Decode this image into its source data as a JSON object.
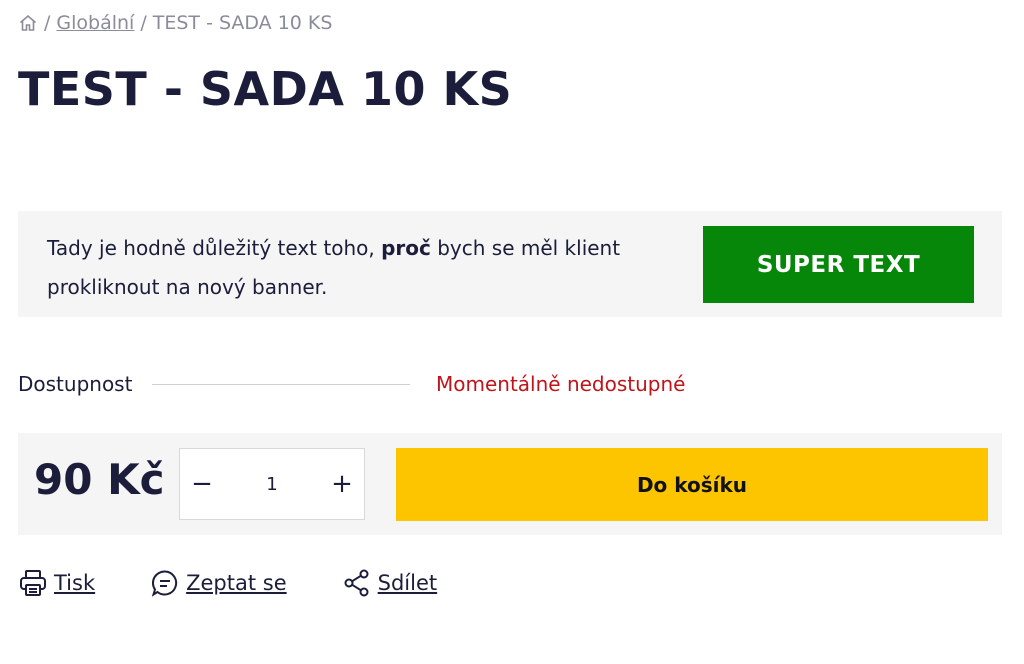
{
  "breadcrumb": {
    "icon": "home-icon",
    "separator": "/",
    "category": "Globální",
    "current": "TEST - SADA 10 KS"
  },
  "product": {
    "title": "TEST - SADA 10 KS"
  },
  "banner": {
    "text_before": "Tady je hodně důležitý text toho, ",
    "text_bold": "proč",
    "text_after": " bych se měl klient prokliknout na nový banner.",
    "button_label": "SUPER TEXT",
    "button_color": "#06870a"
  },
  "availability": {
    "label": "Dostupnost",
    "value": "Momentálně nedostupné",
    "value_color": "#c0141a"
  },
  "purchase": {
    "price": "90 Kč",
    "quantity": "1",
    "minus_label": "−",
    "plus_label": "+",
    "cart_label": "Do košíku",
    "cart_color": "#fcc500"
  },
  "actions": {
    "print": {
      "label": "Tisk",
      "icon": "printer-icon"
    },
    "ask": {
      "label": "Zeptat se",
      "icon": "chat-bubble-icon"
    },
    "share": {
      "label": "Sdílet",
      "icon": "share-icon"
    }
  }
}
